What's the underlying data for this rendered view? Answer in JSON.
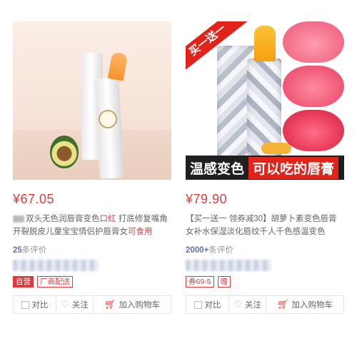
{
  "products": [
    {
      "price": "¥67.05",
      "title_pre": "双头无色润唇膏变色",
      "title_hl1": "口红",
      "title_mid": " 打底修复嘴角开裂脱皮儿童宝宝情侣护唇膏女",
      "title_hl2": "可食用",
      "reviews_count": "25",
      "reviews_suffix": "条评价",
      "tags": [
        "自营",
        "厂商配送"
      ],
      "actions": {
        "compare": "对比",
        "follow": "关注",
        "add_cart": "加入购物车"
      }
    },
    {
      "price": "¥79.90",
      "title": "【买一送一 领券减30】胡萝卜素变色唇膏女补水保湿淡化唇纹千人千色感温变色",
      "ribbon": "买一送一",
      "banner_left": "温感变色",
      "banner_right": "可以吃的唇膏",
      "reviews_count": "2000+",
      "reviews_suffix": "条评价",
      "tags": [
        "券69-5",
        "赠"
      ],
      "actions": {
        "compare": "对比",
        "follow": "关注",
        "add_cart": "加入购物车"
      }
    }
  ],
  "icons": [
    "checkbox-icon",
    "heart-icon",
    "cart-icon"
  ],
  "colors": {
    "price_red": "#e4393c",
    "review_blue": "#646fb0",
    "border": "#e4e4e4"
  }
}
